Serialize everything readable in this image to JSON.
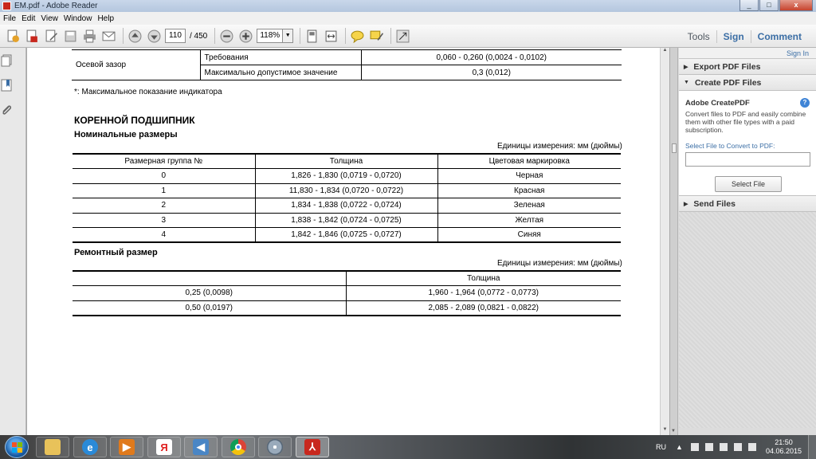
{
  "window": {
    "title": "EM.pdf - Adobe Reader",
    "minimize": "_",
    "maximize": "□",
    "close": "x"
  },
  "menu": [
    "File",
    "Edit",
    "View",
    "Window",
    "Help"
  ],
  "toolbar": {
    "page_current": "110",
    "page_total": "/ 450",
    "zoom": "118%",
    "tools_label": "Tools",
    "sign_label": "Sign",
    "comment_label": "Comment"
  },
  "document": {
    "clearance_table": {
      "row_label": "Осевой зазор",
      "rows": [
        {
          "name": "Требования",
          "value": "0,060 - 0,260 (0,0024 - 0,0102)"
        },
        {
          "name": "Максимально допустимое значение",
          "value": "0,3 (0,012)"
        }
      ]
    },
    "note": "*: Максимальное показание индикатора",
    "heading": "КОРЕННОЙ ПОДШИПНИК",
    "nominal": {
      "subheading": "Номинальные размеры",
      "units": "Единицы измерения: мм (дюймы)",
      "headers": [
        "Размерная группа №",
        "Толщина",
        "Цветовая маркировка"
      ],
      "rows": [
        [
          "0",
          "1,826 - 1,830 (0,0719 - 0,0720)",
          "Черная"
        ],
        [
          "1",
          "11,830 - 1,834 (0,0720 - 0,0722)",
          "Красная"
        ],
        [
          "2",
          "1,834 - 1,838 (0,0722 - 0,0724)",
          "Зеленая"
        ],
        [
          "3",
          "1,838 - 1,842 (0,0724 - 0,0725)",
          "Желтая"
        ],
        [
          "4",
          "1,842 - 1,846 (0,0725 - 0,0727)",
          "Синяя"
        ]
      ]
    },
    "repair": {
      "subheading": "Ремонтный размер",
      "units": "Единицы измерения: мм (дюймы)",
      "headers": [
        "",
        "Толщина"
      ],
      "rows": [
        [
          "0,25 (0,0098)",
          "1,960 - 1,964 (0,0772 - 0,0773)"
        ],
        [
          "0,50 (0,0197)",
          "2,085 - 2,089 (0,0821 - 0,0822)"
        ]
      ]
    }
  },
  "right_panel": {
    "sign_in": "Sign In",
    "export_label": "Export PDF Files",
    "create_label": "Create PDF Files",
    "create_title": "Adobe CreatePDF",
    "create_desc": "Convert files to PDF and easily combine them with other file types with a paid subscription.",
    "select_label": "Select File to Convert to PDF:",
    "select_button": "Select File",
    "send_label": "Send Files"
  },
  "taskbar": {
    "language": "RU",
    "time": "21:50",
    "date": "04.06.2015",
    "apps": [
      "file-explorer",
      "internet-explorer",
      "media-player",
      "yandex-browser",
      "volume-app",
      "chrome",
      "disc-burner",
      "adobe-reader"
    ]
  },
  "colors": {
    "accent": "#3b6ea5",
    "pdf_red": "#c8281e"
  }
}
